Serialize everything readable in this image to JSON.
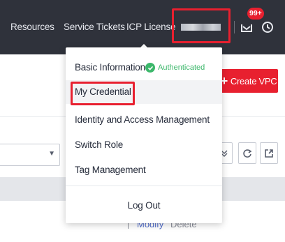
{
  "topbar": {
    "nav": [
      "Resources",
      "Service Tickets",
      "ICP License"
    ],
    "message_badge": "99+",
    "icons": {
      "messages": "envelope-icon",
      "clock": "clock-icon"
    }
  },
  "page": {
    "create_vpc": "Create VPC",
    "row_actions": {
      "modify": "Modify",
      "delete": "Delete"
    }
  },
  "account_menu": {
    "basic_information": "Basic Information",
    "auth_status": "Authenticated",
    "my_credential": "My Credential",
    "iam": "Identity and Access Management",
    "switch_role": "Switch Role",
    "tag_management": "Tag Management",
    "log_out": "Log Out"
  },
  "colors": {
    "topbar": "#2f323b",
    "accent": "#e8202f",
    "authenticated": "#3bb76a",
    "link": "#526ecc"
  }
}
